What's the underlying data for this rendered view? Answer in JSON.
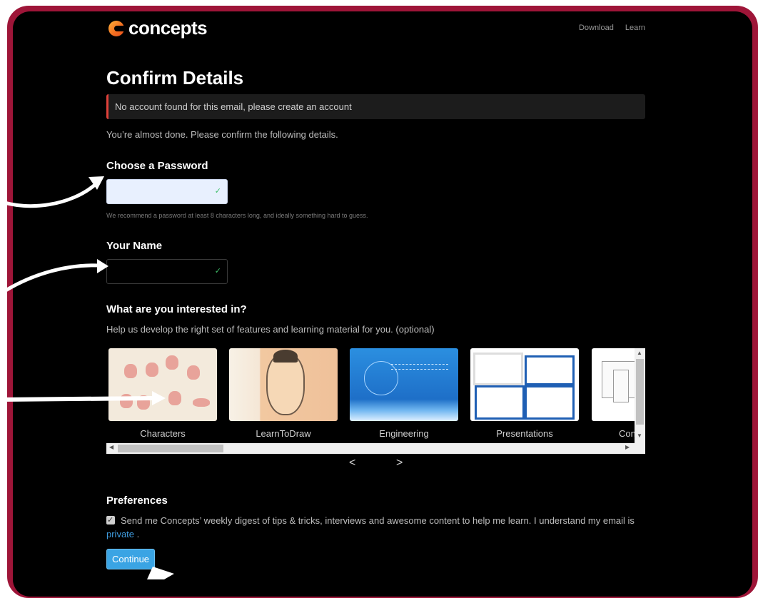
{
  "brand": {
    "name": "concepts",
    "accent": "#f37021",
    "frame_color": "#9e1538"
  },
  "nav": {
    "download": "Download",
    "learn": "Learn"
  },
  "page": {
    "title": "Confirm Details",
    "alert": "No account found for this email, please create an account",
    "intro": "You’re almost done. Please confirm the following details."
  },
  "password": {
    "label": "Choose a Password",
    "value": "",
    "hint": "We recommend a password at least 8 characters long, and ideally something hard to guess.",
    "valid_icon": "check-icon"
  },
  "name": {
    "label": "Your Name",
    "value": "",
    "valid_icon": "check-icon"
  },
  "interests": {
    "title": "What are you interested in?",
    "subtitle": "Help us develop the right set of features and learning material for you. (optional)",
    "cards": [
      {
        "label": "Characters"
      },
      {
        "label": "LearnToDraw"
      },
      {
        "label": "Engineering"
      },
      {
        "label": "Presentations"
      },
      {
        "label": "Con"
      }
    ],
    "prev": "<",
    "next": ">"
  },
  "preferences": {
    "title": "Preferences",
    "checked": true,
    "text_before": "Send me Concepts’ weekly digest of tips & tricks, interviews and awesome content to help me learn. I understand my email is ",
    "link": "private",
    "text_after": " ."
  },
  "continue_button": "Continue"
}
